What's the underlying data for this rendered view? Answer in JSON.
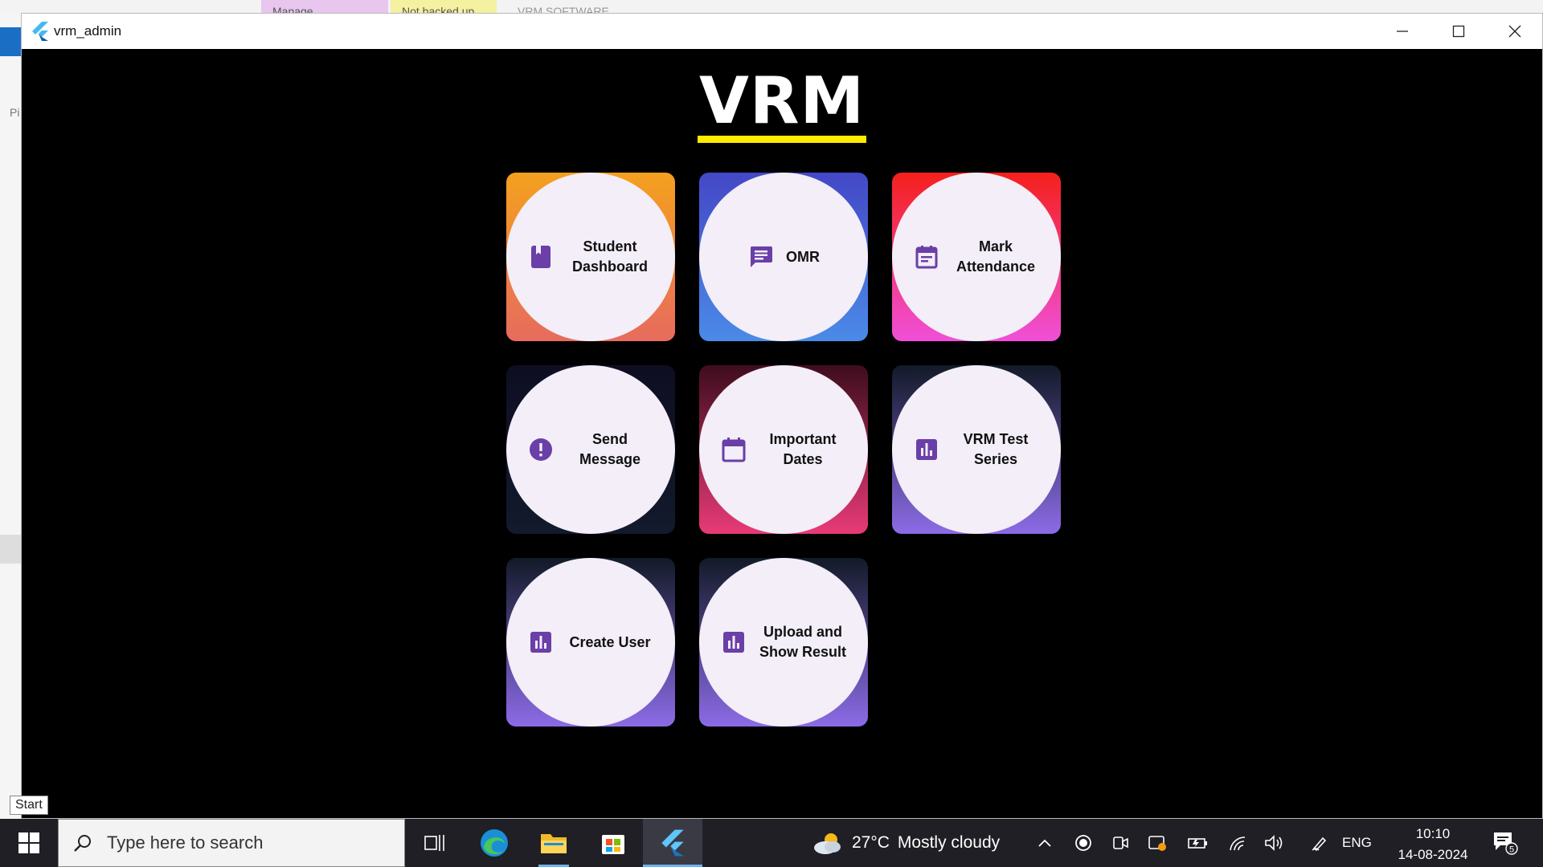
{
  "background": {
    "tabs": [
      "Manage",
      "Not backed up",
      "VRM SOFTWARE"
    ],
    "side_text": "Pi"
  },
  "window": {
    "title": "vrm_admin",
    "controls": {
      "minimize": "–",
      "maximize": "☐",
      "close": "✕"
    }
  },
  "main": {
    "heading": "VRM",
    "heading_underline_color": "#ffea00",
    "cards": [
      {
        "label": "Student Dashboard",
        "icon": "book-icon"
      },
      {
        "label": "OMR",
        "icon": "chat-icon"
      },
      {
        "label": "Mark Attendance",
        "icon": "event-note-icon"
      },
      {
        "label": "Send Message",
        "icon": "alert-circle-icon"
      },
      {
        "label": "Important Dates",
        "icon": "calendar-icon"
      },
      {
        "label": "VRM Test Series",
        "icon": "bar-chart-icon"
      },
      {
        "label": "Create User",
        "icon": "bar-chart-icon"
      },
      {
        "label": "Upload and Show Result",
        "icon": "bar-chart-icon"
      }
    ],
    "icon_color": "#6a3fa8"
  },
  "tooltip": "Start",
  "taskbar": {
    "search_placeholder": "Type here to search",
    "weather": {
      "temp": "27°C",
      "condition": "Mostly cloudy"
    },
    "language": "ENG",
    "time": "10:10",
    "date": "14-08-2024",
    "notification_count": "5"
  }
}
